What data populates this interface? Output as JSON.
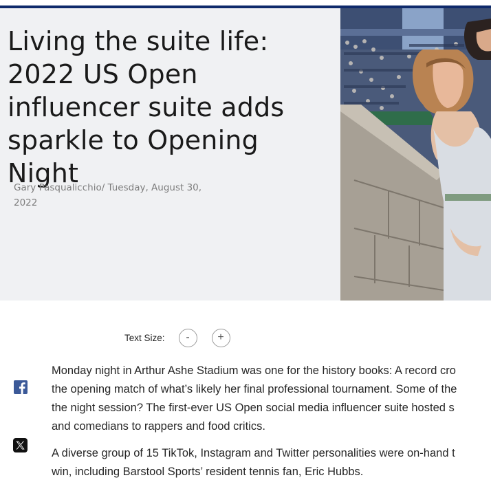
{
  "article": {
    "headline": "Living the suite life: 2022 US Open influencer suite adds sparkle to Opening Night",
    "byline": "Gary Pasqualicchio/ Tuesday, August 30, 2022",
    "hero_image_description_icon": "photo-of-woman-in-stadium"
  },
  "text_size": {
    "label": "Text Size:",
    "decrease": "-",
    "increase": "+"
  },
  "share": {
    "facebook_icon": "facebook-icon",
    "x_icon": "x-icon"
  },
  "body": {
    "paragraphs": [
      {
        "lines": [
          "Monday night in Arthur Ashe Stadium was one for the history books: A record cro",
          "the opening match of what’s likely her final professional tournament. Some of the",
          "the night session? The first-ever US Open social media influencer suite hosted s",
          "and comedians to rappers and food critics."
        ]
      },
      {
        "lines": [
          "A diverse group of 15 TikTok, Instagram and Twitter personalities were on-hand t",
          "win, including Barstool Sports’ resident tennis fan, Eric Hubbs."
        ]
      }
    ]
  },
  "colors": {
    "brand_navy": "#0f2a6b",
    "facebook_blue": "#3b5998",
    "hero_bg": "#f0f1f3"
  }
}
